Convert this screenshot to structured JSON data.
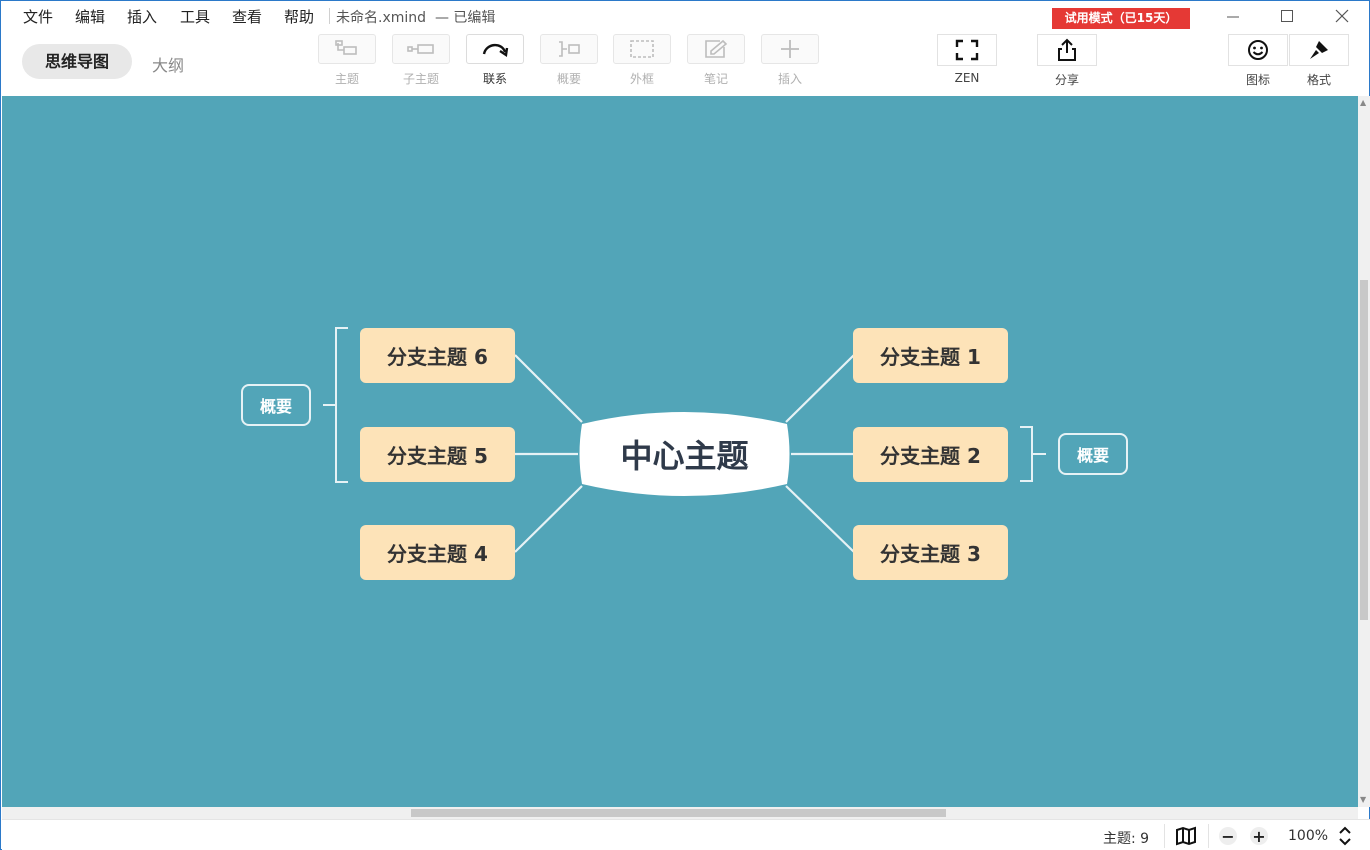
{
  "menu": [
    "文件",
    "编辑",
    "插入",
    "工具",
    "查看",
    "帮助"
  ],
  "document": {
    "title": "未命名.xmind",
    "status": "— 已编辑"
  },
  "trial_badge": "试用模式（已15天）",
  "view_tabs": {
    "mindmap": "思维导图",
    "outline": "大纲"
  },
  "toolbar": [
    {
      "key": "topic",
      "label": "主题",
      "icon": "topic-icon",
      "enabled": false
    },
    {
      "key": "subtopic",
      "label": "子主题",
      "icon": "subtopic-icon",
      "enabled": false
    },
    {
      "key": "relationship",
      "label": "联系",
      "icon": "relationship-curve-icon",
      "enabled": true
    },
    {
      "key": "summary",
      "label": "概要",
      "icon": "summary-brace-icon",
      "enabled": false
    },
    {
      "key": "boundary",
      "label": "外框",
      "icon": "boundary-dashed-box-icon",
      "enabled": false
    },
    {
      "key": "note",
      "label": "笔记",
      "icon": "note-edit-icon",
      "enabled": false
    },
    {
      "key": "insert",
      "label": "插入",
      "icon": "plus-icon",
      "enabled": false
    }
  ],
  "zen": {
    "label": "ZEN",
    "icon": "fullscreen-icon"
  },
  "share": {
    "label": "分享",
    "icon": "share-upload-icon"
  },
  "sidebar_tools": [
    {
      "label": "图标",
      "icon": "smiley-icon"
    },
    {
      "label": "格式",
      "icon": "format-brush-icon"
    }
  ],
  "mindmap": {
    "central": "中心主题",
    "branches": {
      "b1": "分支主题 1",
      "b2": "分支主题 2",
      "b3": "分支主题 3",
      "b4": "分支主题 4",
      "b5": "分支主题 5",
      "b6": "分支主题 6"
    },
    "summaries": {
      "left": "概要",
      "right": "概要"
    },
    "colors": {
      "canvas": "#52a5b8",
      "branch": "#fde3b8",
      "central": "#ffffff",
      "line": "#e6f2f5"
    }
  },
  "status": {
    "topic_count": "主题: 9",
    "zoom": "100%",
    "icons": [
      "map-book-icon",
      "zoom-out-icon",
      "zoom-in-icon",
      "zoom-stepper-icon"
    ]
  }
}
